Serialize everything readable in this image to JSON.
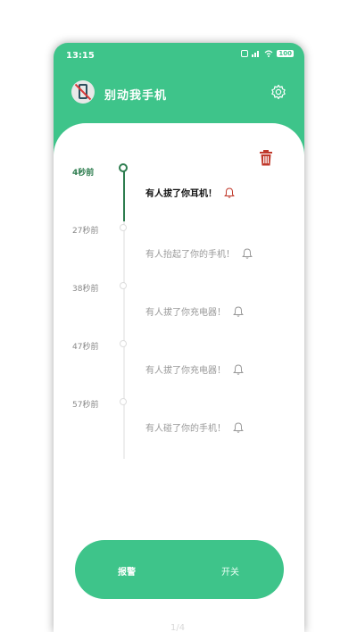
{
  "status_bar": {
    "time": "13:15",
    "icons": [
      "wifi-icon",
      "signal-icon",
      "battery-icon"
    ],
    "battery": "100"
  },
  "app_bar": {
    "title": "别动我手机",
    "logo_icon": "no-phone-icon",
    "settings_icon": "gear-icon"
  },
  "toolbar": {
    "delete_icon": "trash-icon"
  },
  "events": [
    {
      "time": "4秒前",
      "message": "有人拔了你耳机！",
      "active": true
    },
    {
      "time": "27秒前",
      "message": "有人抬起了你的手机！",
      "active": false
    },
    {
      "time": "38秒前",
      "message": "有人拔了你充电器！",
      "active": false
    },
    {
      "time": "47秒前",
      "message": "有人拔了你充电器！",
      "active": false
    },
    {
      "time": "57秒前",
      "message": "有人碰了你的手机！",
      "active": false
    }
  ],
  "bottom": {
    "left_label": "报警",
    "right_label": "开关"
  },
  "page_indicator": "1/4",
  "colors": {
    "accent": "#3ec48a",
    "timeline_active": "#2e7d4f",
    "alert": "#c0392b"
  }
}
